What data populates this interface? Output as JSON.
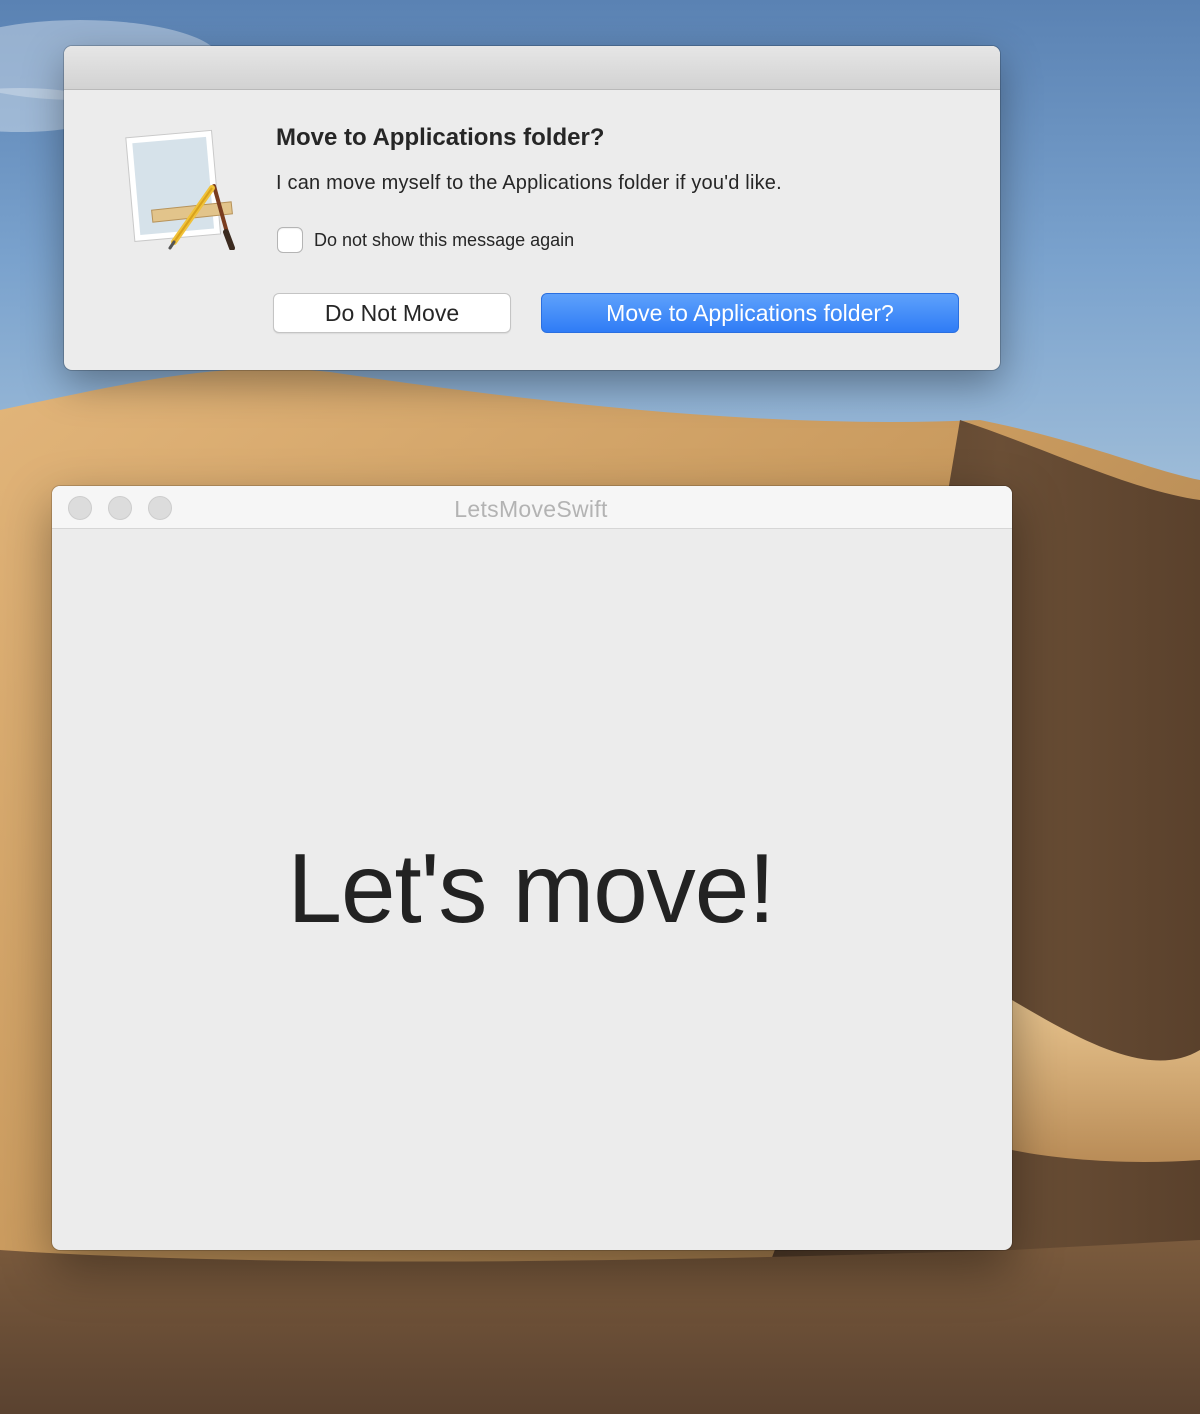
{
  "colors": {
    "accent_blue": "#2f7cf6",
    "window_background": "#ececec",
    "text_primary": "#262626",
    "window_title_inactive": "#b3b3b3"
  },
  "alert": {
    "icon": "app-icon-pencil-ruler-brush",
    "title": "Move to Applications folder?",
    "message": "I can move myself to the Applications folder if you'd like.",
    "suppress_checkbox": {
      "label": "Do not show this message again",
      "checked": false
    },
    "buttons": {
      "secondary_label": "Do Not Move",
      "primary_label": "Move to Applications folder?"
    }
  },
  "app_window": {
    "title": "LetsMoveSwift",
    "traffic_lights_state": "inactive",
    "content_text": "Let's move!"
  }
}
